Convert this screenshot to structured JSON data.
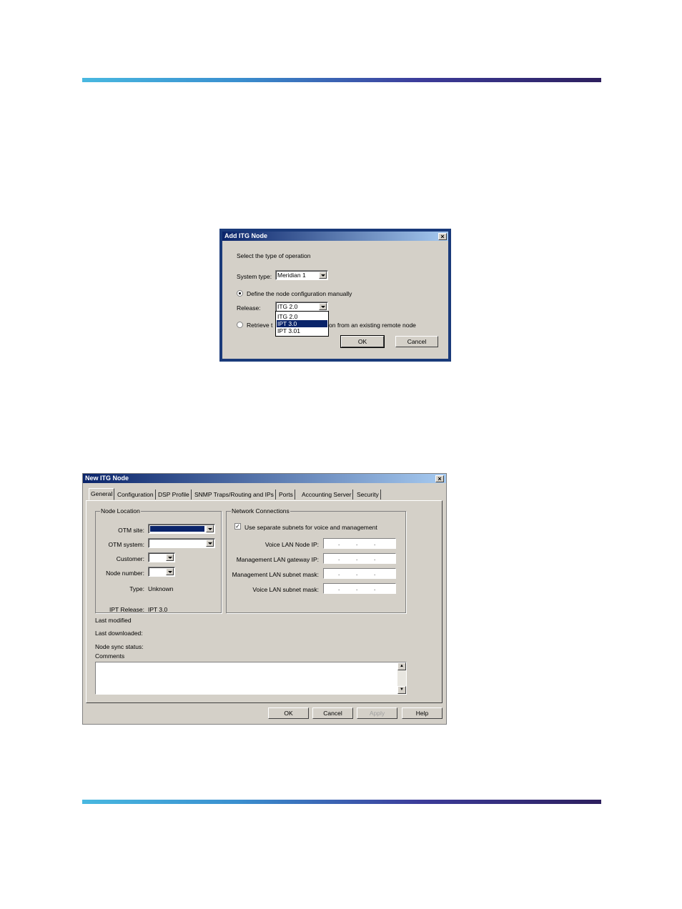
{
  "add_dialog": {
    "title": "Add ITG Node",
    "instruction": "Select the type of operation",
    "system_type_label": "System type:",
    "system_type_value": "Meridian 1",
    "radio_manual_label": "Define the node configuration manually",
    "release_label": "Release:",
    "release_value": "ITG 2.0",
    "release_options": [
      "ITG 2.0",
      "IPT 3.0",
      "IPT 3.01"
    ],
    "radio_retrieve_prefix": "Retrieve t",
    "radio_retrieve_suffix": "on from an existing remote node",
    "ok_label": "OK",
    "cancel_label": "Cancel",
    "close_glyph": "×"
  },
  "new_dialog": {
    "title": "New ITG Node",
    "close_glyph": "×",
    "tabs": [
      "General",
      "Configuration",
      "DSP Profile",
      "SNMP Traps/Routing and IPs",
      "Ports",
      "Accounting Server",
      "Security"
    ],
    "node_location": {
      "group_title": "Node Location",
      "otm_site_label": "OTM site:",
      "otm_system_label": "OTM system:",
      "customer_label": "Customer:",
      "node_number_label": "Node number:",
      "type_label": "Type:",
      "type_value": "Unknown",
      "ipt_release_label": "IPT Release:",
      "ipt_release_value": "IPT 3.0"
    },
    "network": {
      "group_title": "Network Connections",
      "use_separate_label": "Use separate subnets for voice and management",
      "voice_lan_ip_label": "Voice LAN Node IP:",
      "mgmt_gateway_label": "Management LAN gateway IP:",
      "mgmt_subnet_label": "Management LAN subnet mask:",
      "voice_subnet_label": "Voice LAN subnet mask:"
    },
    "last_modified_label": "Last modified",
    "last_downloaded_label": "Last downloaded:",
    "node_sync_label": "Node sync status:",
    "comments_label": "Comments",
    "ok_label": "OK",
    "cancel_label": "Cancel",
    "apply_label": "Apply",
    "help_label": "Help"
  }
}
